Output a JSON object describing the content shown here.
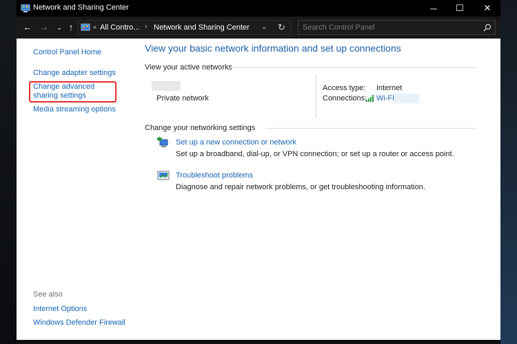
{
  "window": {
    "title": "Network and Sharing Center",
    "controls": {
      "minimize": "─",
      "maximize": "☐",
      "close": "✕"
    }
  },
  "nav": {
    "back": "←",
    "forward": "→",
    "recent": "⌄",
    "up": "↑"
  },
  "address": {
    "guillemet": "«",
    "crumbs": [
      "All Contro...",
      "Network and Sharing Center"
    ],
    "separator": "›",
    "dropdown": "⌄",
    "refresh": "↻"
  },
  "search": {
    "placeholder": "Search Control Panel",
    "value": ""
  },
  "sidebar": {
    "items": [
      {
        "label": "Control Panel Home"
      },
      {
        "label": "Change adapter settings"
      },
      {
        "label": "Change advanced sharing settings",
        "highlighted": true
      },
      {
        "label": "Media streaming options"
      }
    ],
    "see_also_label": "See also",
    "see_also": [
      {
        "label": "Internet Options"
      },
      {
        "label": "Windows Defender Firewall"
      }
    ]
  },
  "main": {
    "title": "View your basic network information and set up connections",
    "active_networks_heading": "View your active networks",
    "network": {
      "type": "Private network",
      "access_type_label": "Access type:",
      "access_type_value": "Internet",
      "connections_label": "Connections:",
      "connection_name": "Wi-Fi"
    },
    "change_settings_heading": "Change your networking settings",
    "tasks": [
      {
        "link": "Set up a new connection or network",
        "description": "Set up a broadband, dial-up, or VPN connection; or set up a router or access point."
      },
      {
        "link": "Troubleshoot problems",
        "description": "Diagnose and repair network problems, or get troubleshooting information."
      }
    ]
  },
  "colors": {
    "link": "#1564b5",
    "title": "#1a5ea8",
    "highlight_border": "#e32b2b",
    "wifi_green": "#2e9e3e"
  }
}
